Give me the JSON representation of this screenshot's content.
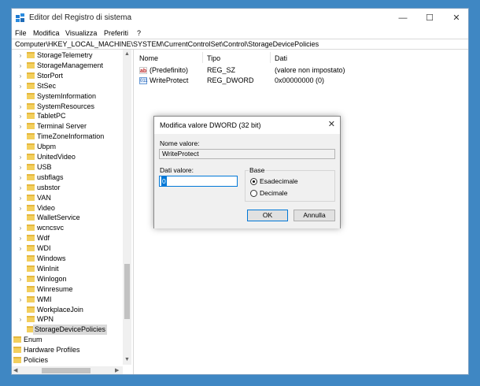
{
  "window": {
    "title": "Editor del Registro di sistema",
    "controls": {
      "minimize": "—",
      "maximize": "☐",
      "close": "✕"
    }
  },
  "menu": [
    "File",
    "Modifica",
    "Visualizza",
    "Preferiti",
    "?"
  ],
  "address": "Computer\\HKEY_LOCAL_MACHINE\\SYSTEM\\CurrentControlSet\\Control\\StorageDevicePolicies",
  "tree": {
    "items": [
      {
        "label": "StorageTelemetry",
        "expandable": true
      },
      {
        "label": "StorageManagement",
        "expandable": true
      },
      {
        "label": "StorPort",
        "expandable": true
      },
      {
        "label": "StSec",
        "expandable": true
      },
      {
        "label": "SystemInformation",
        "expandable": false
      },
      {
        "label": "SystemResources",
        "expandable": true
      },
      {
        "label": "TabletPC",
        "expandable": true
      },
      {
        "label": "Terminal Server",
        "expandable": true
      },
      {
        "label": "TimeZoneInformation",
        "expandable": false
      },
      {
        "label": "Ubpm",
        "expandable": false
      },
      {
        "label": "UnitedVideo",
        "expandable": true
      },
      {
        "label": "USB",
        "expandable": true
      },
      {
        "label": "usbflags",
        "expandable": true
      },
      {
        "label": "usbstor",
        "expandable": true
      },
      {
        "label": "VAN",
        "expandable": true
      },
      {
        "label": "Video",
        "expandable": true
      },
      {
        "label": "WalletService",
        "expandable": false
      },
      {
        "label": "wcncsvc",
        "expandable": true
      },
      {
        "label": "Wdf",
        "expandable": true
      },
      {
        "label": "WDI",
        "expandable": true
      },
      {
        "label": "Windows",
        "expandable": false
      },
      {
        "label": "WinInit",
        "expandable": false
      },
      {
        "label": "Winlogon",
        "expandable": true
      },
      {
        "label": "Winresume",
        "expandable": false
      },
      {
        "label": "WMI",
        "expandable": true
      },
      {
        "label": "WorkplaceJoin",
        "expandable": false
      },
      {
        "label": "WPN",
        "expandable": true
      },
      {
        "label": "StorageDevicePolicies",
        "expandable": false,
        "selected": true
      },
      {
        "label": "Enum",
        "expandable": true,
        "level": 1
      },
      {
        "label": "Hardware Profiles",
        "expandable": true,
        "level": 1
      },
      {
        "label": "Policies",
        "expandable": true,
        "level": 1
      }
    ]
  },
  "list": {
    "columns": [
      "Nome",
      "Tipo",
      "Dati"
    ],
    "rows": [
      {
        "icon": "ab",
        "name": "(Predefinito)",
        "type": "REG_SZ",
        "data": "(valore non impostato)"
      },
      {
        "icon": "011",
        "name": "WriteProtect",
        "type": "REG_DWORD",
        "data": "0x00000000 (0)"
      }
    ]
  },
  "dialog": {
    "title": "Modifica valore DWORD (32 bit)",
    "close": "✕",
    "name_label": "Nome valore:",
    "name_value": "WriteProtect",
    "data_label": "Dati valore:",
    "data_value": "0",
    "base_label": "Base",
    "radio_hex": "Esadecimale",
    "radio_dec": "Decimale",
    "selected_base": "Esadecimale",
    "ok": "OK",
    "cancel": "Annulla"
  },
  "scroll": {
    "up": "▲",
    "down": "▼",
    "left": "◀",
    "right": "▶"
  }
}
